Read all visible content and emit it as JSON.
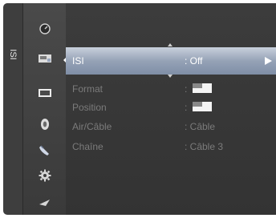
{
  "sidebar": {
    "label": "ISI"
  },
  "icons": [
    "clock-icon",
    "input-icon",
    "picture-icon",
    "sound-icon",
    "satellite-icon",
    "gear-icon",
    "antenna-icon"
  ],
  "menu": {
    "selected": {
      "label": "ISI",
      "value": ": Off"
    },
    "items": [
      {
        "label": "Format",
        "value_sep": ":"
      },
      {
        "label": "Position",
        "value_sep": ":"
      },
      {
        "label": "Air/Câble",
        "value": ": Câble"
      },
      {
        "label": "Chaîne",
        "value": ": Câble 3"
      }
    ]
  }
}
